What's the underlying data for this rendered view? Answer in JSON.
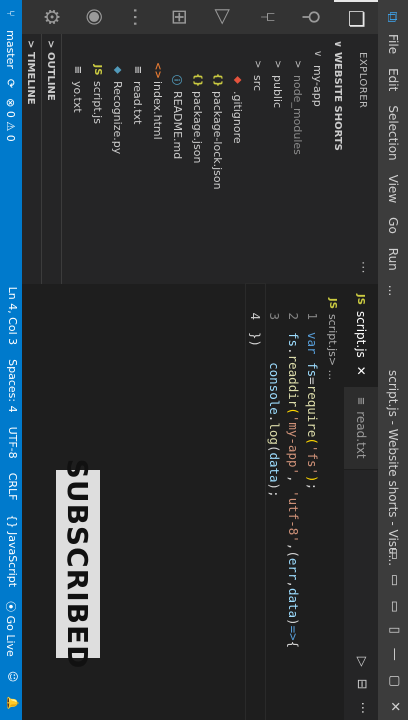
{
  "titlebar": {
    "menu": [
      "File",
      "Edit",
      "Selection",
      "View",
      "Go",
      "Run",
      "..."
    ],
    "title": "script.js - Website shorts - Visu...",
    "window_controls": [
      "▭",
      "▭",
      "▭",
      "▯",
      "—",
      "▢",
      "✕"
    ]
  },
  "sidebar": {
    "header": "EXPLORER",
    "more": "···",
    "section": "WEBSITE SHORTS",
    "tree": [
      {
        "label": "my-app",
        "indent": 1,
        "chevron": "∨",
        "icon": "",
        "color": "#cccccc"
      },
      {
        "label": "node_modules",
        "indent": 2,
        "chevron": ">",
        "icon": "",
        "color": "#8c8c8c"
      },
      {
        "label": "public",
        "indent": 2,
        "chevron": ">",
        "icon": "",
        "color": "#cccccc"
      },
      {
        "label": "src",
        "indent": 2,
        "chevron": ">",
        "icon": "",
        "color": "#cccccc"
      },
      {
        "label": ".gitignore",
        "indent": 2,
        "chevron": "",
        "icon": "◆",
        "icon_color": "#e5533d",
        "color": "#cccccc"
      },
      {
        "label": "package-lock.json",
        "indent": 2,
        "chevron": "",
        "icon": "{}",
        "icon_color": "#cbcb41",
        "color": "#cccccc"
      },
      {
        "label": "package.json",
        "indent": 2,
        "chevron": "",
        "icon": "{}",
        "icon_color": "#cbcb41",
        "color": "#cccccc"
      },
      {
        "label": "README.md",
        "indent": 2,
        "chevron": "",
        "icon": "ⓘ",
        "icon_color": "#519aba",
        "color": "#cccccc"
      },
      {
        "label": "index.html",
        "indent": 1,
        "chevron": "",
        "icon": "<>",
        "icon_color": "#e37933",
        "color": "#cccccc"
      },
      {
        "label": "read.txt",
        "indent": 1,
        "chevron": "",
        "icon": "≡",
        "icon_color": "#cccccc",
        "color": "#cccccc"
      },
      {
        "label": "Recognize.py",
        "indent": 1,
        "chevron": "",
        "icon": "◆",
        "icon_color": "#519aba",
        "color": "#cccccc"
      },
      {
        "label": "script.js",
        "indent": 1,
        "chevron": "",
        "icon": "JS",
        "icon_color": "#cbcb41",
        "color": "#cccccc"
      },
      {
        "label": "yo.txt",
        "indent": 1,
        "chevron": "",
        "icon": "≡",
        "icon_color": "#cccccc",
        "color": "#cccccc"
      }
    ],
    "outline": "OUTLINE",
    "timeline": "TIMELINE"
  },
  "tabs": [
    {
      "icon": "JS",
      "label": "script.js",
      "close": "✕",
      "active": true
    },
    {
      "icon": "≡",
      "label": "read.txt",
      "close": "",
      "active": false
    }
  ],
  "editor_toolbar": [
    "▷",
    "⊟",
    "···"
  ],
  "breadcrumb": {
    "icon": "JS",
    "file": "script.js",
    "rest": " > ..."
  },
  "code_lines": [
    {
      "num": "1",
      "tokens": [
        [
          "kw",
          "var "
        ],
        [
          "id",
          "fs"
        ],
        [
          "pn",
          "="
        ],
        [
          "fn",
          "require"
        ],
        [
          "par",
          "("
        ],
        [
          "str",
          "'fs'"
        ],
        [
          "par",
          ")"
        ],
        [
          "pn",
          ";"
        ]
      ]
    },
    {
      "num": "2",
      "tokens": [
        [
          "id",
          "fs"
        ],
        [
          "pn",
          "."
        ],
        [
          "fn",
          "readdir"
        ],
        [
          "par",
          "("
        ],
        [
          "str",
          "'my-app'"
        ],
        [
          "pn",
          ", "
        ],
        [
          "str",
          "'utf-8'"
        ],
        [
          "pn",
          ","
        ],
        [
          "pn",
          "("
        ],
        [
          "id",
          "err"
        ],
        [
          "pn",
          ","
        ],
        [
          "id",
          "data"
        ],
        [
          "pn",
          ")"
        ],
        [
          "kw",
          "=>"
        ],
        [
          "pn",
          "{"
        ]
      ]
    },
    {
      "num": "3",
      "tokens": [
        [
          "pn",
          "    "
        ],
        [
          "id",
          "console"
        ],
        [
          "pn",
          "."
        ],
        [
          "fn",
          "log"
        ],
        [
          "pn",
          "("
        ],
        [
          "id",
          "data"
        ],
        [
          "pn",
          ");"
        ]
      ]
    },
    {
      "num": "4",
      "tokens": [
        [
          "pn",
          "})"
        ],
        [
          "pn",
          ""
        ]
      ]
    }
  ],
  "overlay": {
    "subscribe": "SUBSCRIBED"
  },
  "status": {
    "branch": "master",
    "sync": "⟳",
    "problems": "⊗ 0 ⚠ 0",
    "position": "Ln 4, Col 3",
    "spaces": "Spaces: 4",
    "encoding": "UTF-8",
    "eol": "CRLF",
    "language": "{} JavaScript",
    "golive": "⦿ Go Live",
    "feedback": "☺",
    "bell": "🔔"
  },
  "colors": {
    "accent": "#007acc",
    "editor_bg": "#1e1e1e",
    "sidebar_bg": "#252526"
  }
}
